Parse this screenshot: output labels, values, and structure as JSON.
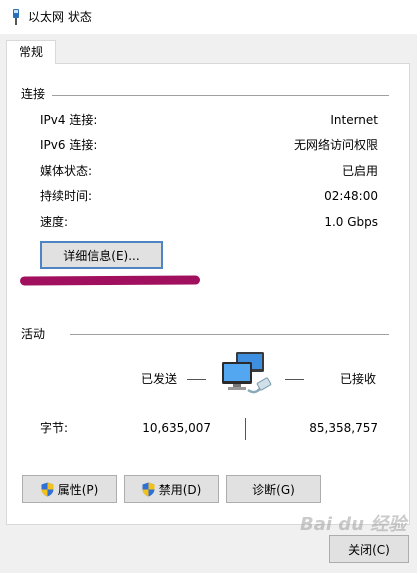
{
  "window": {
    "title": "以太网 状态",
    "icon": "ethernet-adapter-icon"
  },
  "tabs": [
    {
      "label": "常规",
      "selected": true
    }
  ],
  "connection": {
    "group_label": "连接",
    "rows": [
      {
        "label": "IPv4 连接:",
        "value": "Internet"
      },
      {
        "label": "IPv6 连接:",
        "value": "无网络访问权限"
      },
      {
        "label": "媒体状态:",
        "value": "已启用"
      },
      {
        "label": "持续时间:",
        "value": "02:48:00"
      },
      {
        "label": "速度:",
        "value": "1.0 Gbps"
      }
    ],
    "details_button": "详细信息(E)..."
  },
  "activity": {
    "group_label": "活动",
    "sent_label": "已发送",
    "received_label": "已接收",
    "bytes_label": "字节:",
    "bytes_sent": "10,635,007",
    "bytes_received": "85,358,757",
    "icon": "network-computers-icon"
  },
  "action_buttons": {
    "properties": "属性(P)",
    "disable": "禁用(D)",
    "diagnose": "诊断(G)"
  },
  "close_button": "关闭(C)",
  "watermark": "Bai du 经验",
  "colors": {
    "highlight_mark": "#a1105f",
    "focus_border": "#4e84c4",
    "dialog_background": "#f0f0f0",
    "button_face": "#e1e1e1"
  }
}
